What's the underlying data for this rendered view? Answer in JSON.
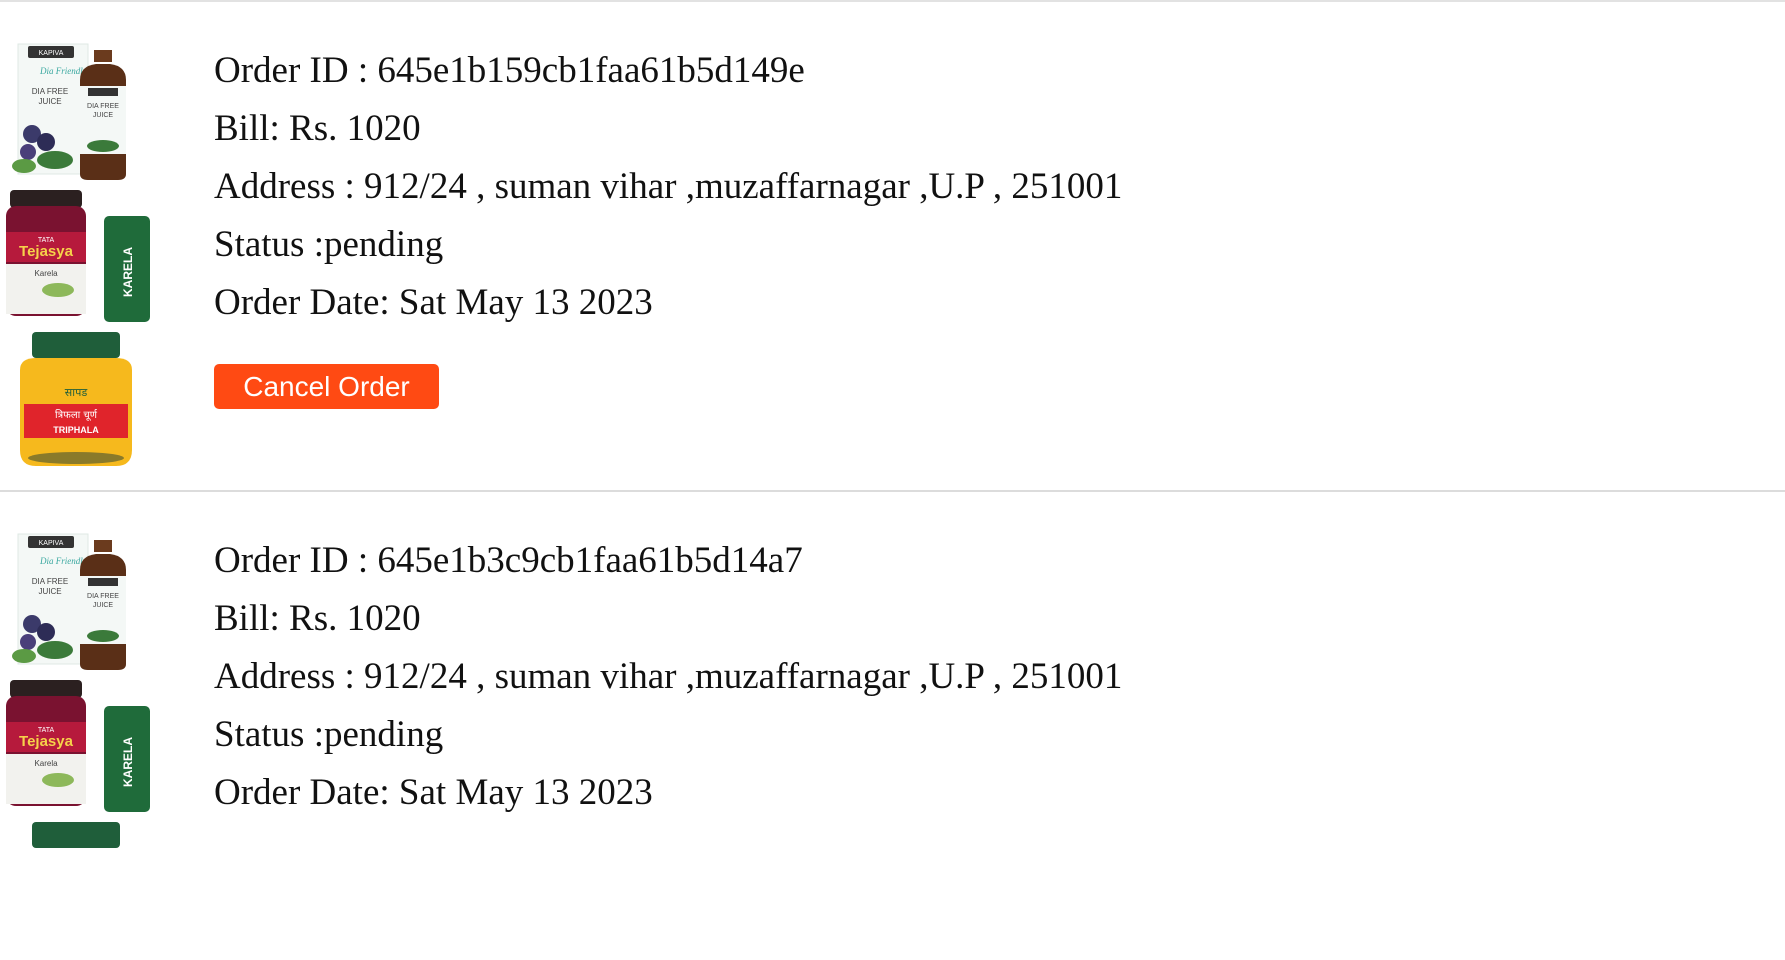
{
  "orders": [
    {
      "order_id_text": "Order ID : 645e1b159cb1faa61b5d149e",
      "bill_text": "Bill: Rs. 1020",
      "address_text": "Address : 912/24 , suman vihar ,muzaffarnagar ,U.P , 251001",
      "status_text": "Status :pending",
      "date_text": "Order Date: Sat May 13 2023",
      "cancel_label": "Cancel Order",
      "products": [
        {
          "brand": "KAPIVA",
          "name": "Dia Free Juice",
          "labels": [
            "DIA FREE",
            "JUICE"
          ]
        },
        {
          "brand": "TATA",
          "name": "Tejasya",
          "sub": "Karela",
          "side_label": "KARELA"
        },
        {
          "name": "TRIPHALA",
          "devanagari": "त्रिफला चूर्ण",
          "brand_devanagari": "सापड"
        }
      ]
    },
    {
      "order_id_text": "Order ID : 645e1b3c9cb1faa61b5d14a7",
      "bill_text": "Bill: Rs. 1020",
      "address_text": "Address : 912/24 , suman vihar ,muzaffarnagar ,U.P , 251001",
      "status_text": "Status :pending",
      "date_text": "Order Date: Sat May 13 2023",
      "products": [
        {
          "brand": "KAPIVA",
          "name": "Dia Free Juice",
          "labels": [
            "DIA FREE",
            "JUICE"
          ]
        },
        {
          "brand": "TATA",
          "name": "Tejasya",
          "sub": "Karela",
          "side_label": "KARELA"
        }
      ]
    }
  ],
  "colors": {
    "cancel_button": "#ff4a13",
    "divider": "#dcdcdc",
    "karela_green": "#1f6b3a"
  }
}
